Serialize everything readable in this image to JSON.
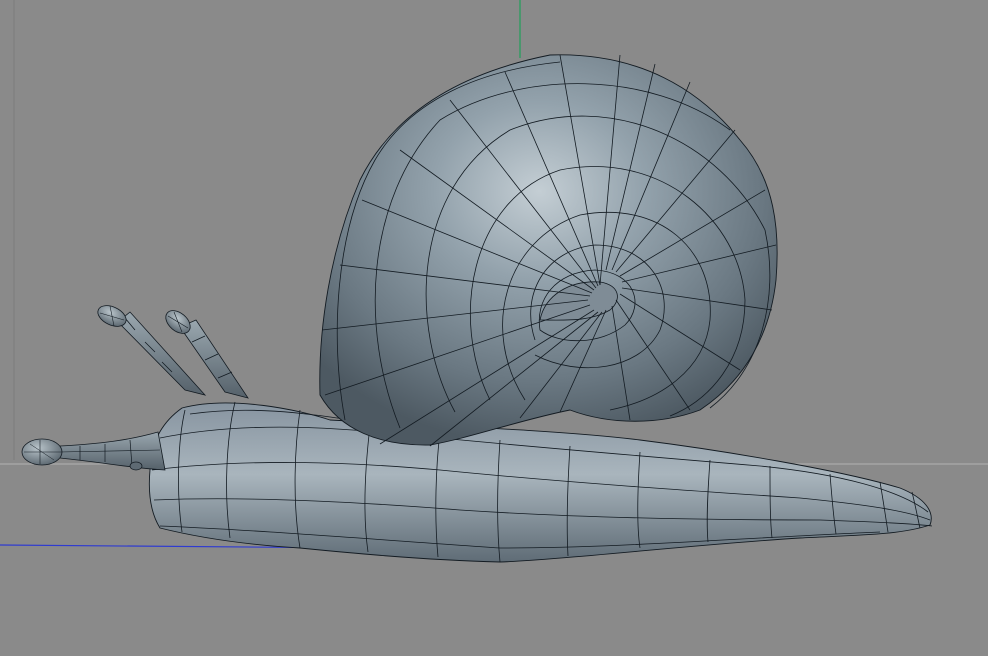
{
  "viewport": {
    "name": "3d-viewport",
    "object": "snail-mesh",
    "display_mode": "gouraud-shading-lines",
    "colors": {
      "background": "#8a8a8a",
      "mesh_base": "#6f7e88",
      "mesh_highlight": "#b6c1c8",
      "mesh_shadow": "#4b5761",
      "wireframe": "#131b22",
      "axis_y": "#1fa05a",
      "axis_z": "#2f3bd0",
      "horizon": "#b5b5b5",
      "world_axis_x": "#777777"
    }
  }
}
